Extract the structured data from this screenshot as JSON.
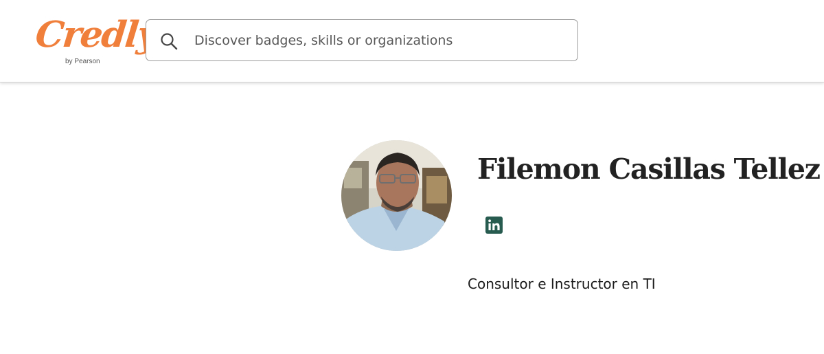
{
  "header": {
    "logo": {
      "wordmark": "Credly",
      "subtitle": "by Pearson",
      "color": "#f07f3c"
    },
    "search": {
      "placeholder": "Discover badges, skills or organizations",
      "value": "",
      "icon": "search-icon"
    }
  },
  "profile": {
    "name": "Filemon Casillas Tellez",
    "avatar": "profile-photo",
    "social": [
      {
        "network": "LinkedIn",
        "icon": "linkedin-icon",
        "color": "#275b50"
      }
    ],
    "bio": "Consultor e Instructor en TI"
  }
}
